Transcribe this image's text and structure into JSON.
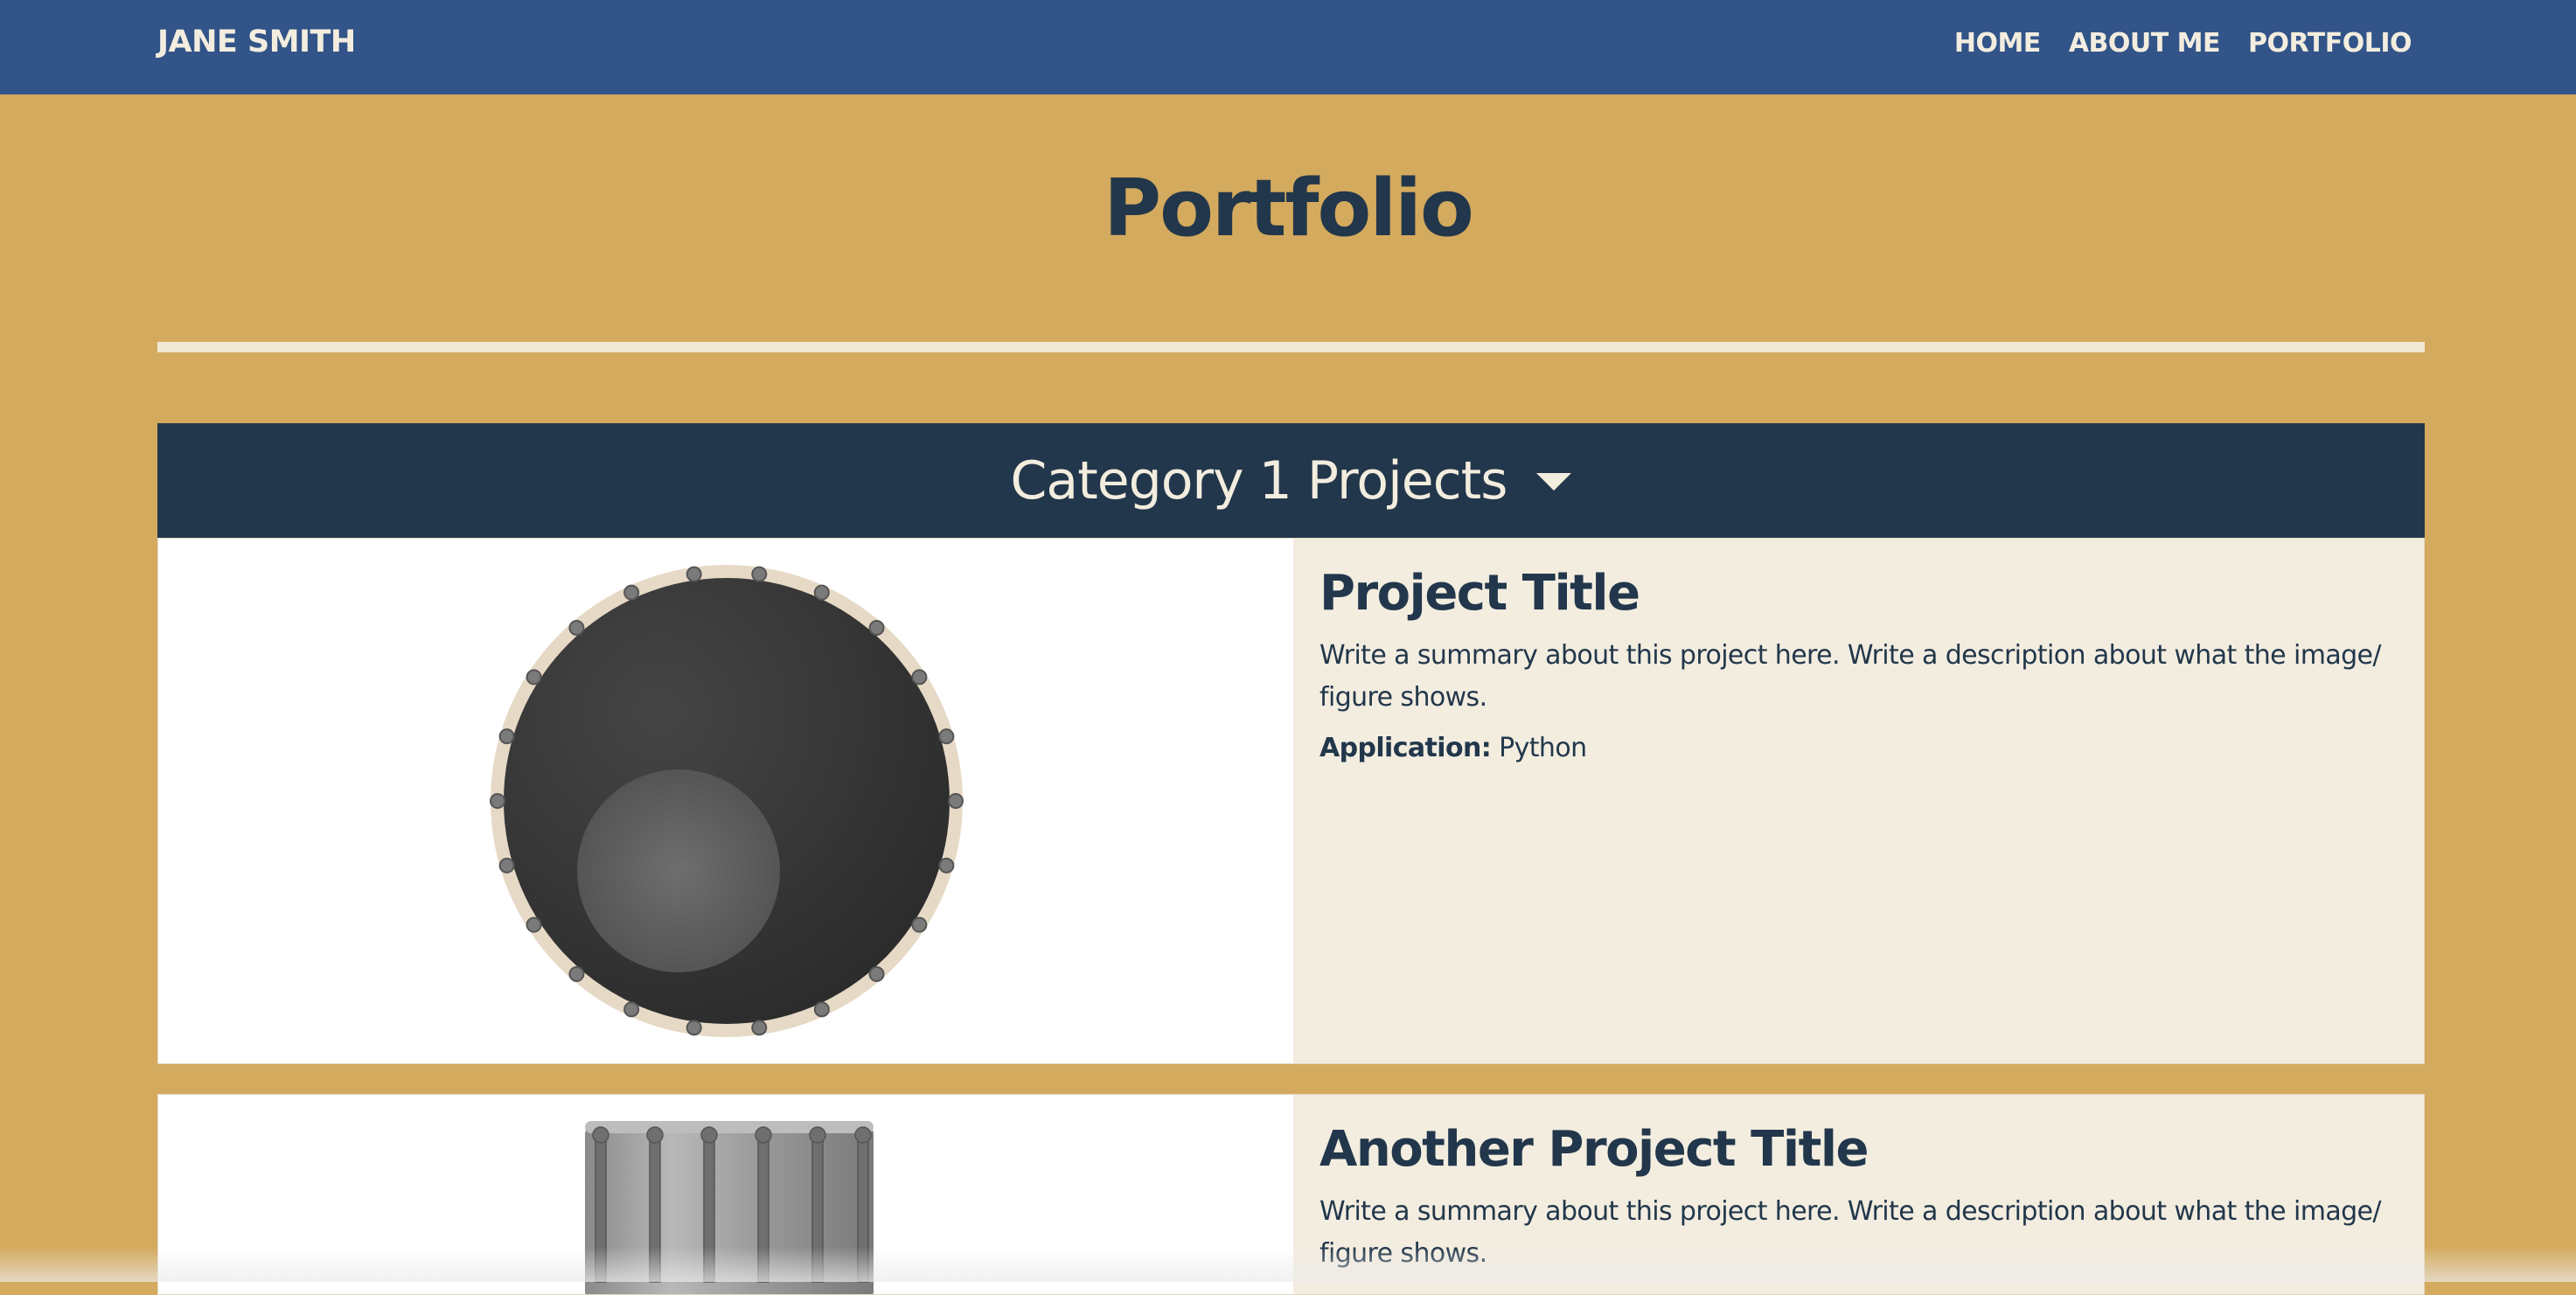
{
  "navbar": {
    "brand": "JANE SMITH",
    "links": [
      "HOME",
      "ABOUT ME",
      "PORTFOLIO"
    ]
  },
  "page": {
    "title": "Portfolio"
  },
  "category": {
    "label": "Category 1 Projects",
    "icon": "caret-down-icon"
  },
  "projects": [
    {
      "title": "Project Title",
      "summary": "Write a summary about this project here. Write a description about what the image/ figure shows.",
      "application_label": "Application:",
      "application_value": "Python",
      "image_icon": "drum-top-view-image"
    },
    {
      "title": "Another Project Title",
      "summary": "Write a summary about this project here. Write a description about what the image/ figure shows.",
      "image_icon": "drum-side-view-image"
    }
  ],
  "colors": {
    "background": "#d4aa5e",
    "navbar": "#325488",
    "dark": "#22374b",
    "cream": "#f3ede0"
  }
}
